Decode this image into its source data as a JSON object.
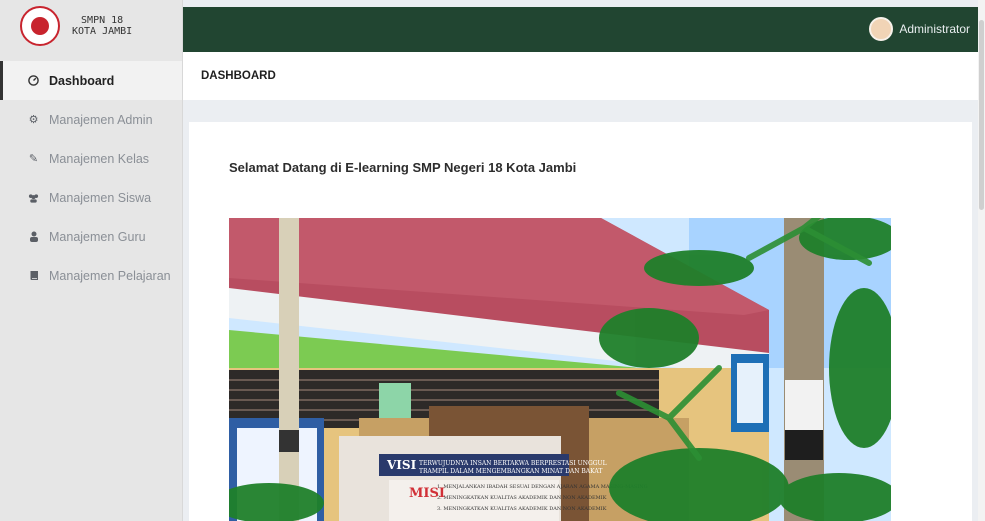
{
  "brand": {
    "line1": "SMPN 18",
    "line2": "KOTA JAMBI"
  },
  "sidebar": {
    "items": [
      {
        "label": "Dashboard",
        "icon": "dashboard-icon",
        "active": true
      },
      {
        "label": "Manajemen Admin",
        "icon": "gear-icon"
      },
      {
        "label": "Manajemen Kelas",
        "icon": "pencil-icon"
      },
      {
        "label": "Manajemen Siswa",
        "icon": "users-icon"
      },
      {
        "label": "Manajemen Guru",
        "icon": "user-icon"
      },
      {
        "label": "Manajemen Pelajaran",
        "icon": "book-icon"
      }
    ]
  },
  "topbar": {
    "user_label": "Administrator"
  },
  "breadcrumb": {
    "title": "DASHBOARD"
  },
  "main": {
    "welcome": "Selamat Datang di E-learning SMP Negeri 18 Kota Jambi"
  },
  "photo_signboard": {
    "visi_title": "VISI",
    "visi_line1": "TERWUJUDNYA INSAN BERTAKWA BERPRESTASI UNGGUL",
    "visi_line2": "TRAMPIL DALAM MENGEMBANGKAN MINAT DAN BAKAT",
    "misi_title": "MISI",
    "misi_line1": "1. MENJALANKAN IBADAH SESUAI DENGAN AJARAN AGAMA MASING-MASING",
    "misi_line2": "2. MENINGKATKAN KUALITAS AKADEMIK DAN NON AKADEMIK",
    "misi_line3": "3. MENINGKATKAN KUALITAS AKADEMIK DAN NON AKADEMIK"
  },
  "colors": {
    "topbar": "#214531",
    "sidebar": "#e6e6e6",
    "background": "#ebeef2",
    "logo_red": "#c8242e"
  }
}
